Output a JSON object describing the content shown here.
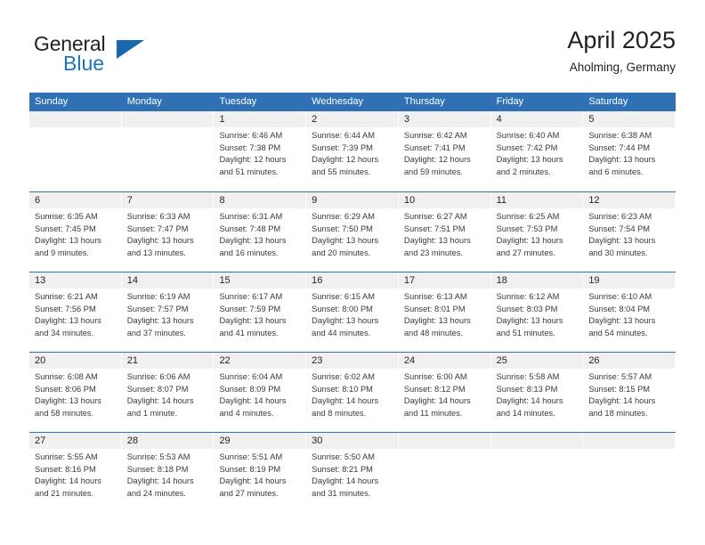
{
  "brand": {
    "name_top": "General",
    "name_bottom": "Blue",
    "triangle_icon": "blue-triangle-icon",
    "accent_color": "#1b75bb"
  },
  "header": {
    "title": "April 2025",
    "subtitle": "Aholming, Germany"
  },
  "theme": {
    "header_blue": "#3071b5",
    "daynum_band": "#f0f0f0",
    "text": "#231f20",
    "cell_text": "#3a3a3a"
  },
  "calendar": {
    "day_headers": [
      "Sunday",
      "Monday",
      "Tuesday",
      "Wednesday",
      "Thursday",
      "Friday",
      "Saturday"
    ],
    "weeks": [
      [
        {
          "day": "",
          "lines": []
        },
        {
          "day": "",
          "lines": []
        },
        {
          "day": "1",
          "lines": [
            "Sunrise: 6:46 AM",
            "Sunset: 7:38 PM",
            "Daylight: 12 hours",
            "and 51 minutes."
          ]
        },
        {
          "day": "2",
          "lines": [
            "Sunrise: 6:44 AM",
            "Sunset: 7:39 PM",
            "Daylight: 12 hours",
            "and 55 minutes."
          ]
        },
        {
          "day": "3",
          "lines": [
            "Sunrise: 6:42 AM",
            "Sunset: 7:41 PM",
            "Daylight: 12 hours",
            "and 59 minutes."
          ]
        },
        {
          "day": "4",
          "lines": [
            "Sunrise: 6:40 AM",
            "Sunset: 7:42 PM",
            "Daylight: 13 hours",
            "and 2 minutes."
          ]
        },
        {
          "day": "5",
          "lines": [
            "Sunrise: 6:38 AM",
            "Sunset: 7:44 PM",
            "Daylight: 13 hours",
            "and 6 minutes."
          ]
        }
      ],
      [
        {
          "day": "6",
          "lines": [
            "Sunrise: 6:35 AM",
            "Sunset: 7:45 PM",
            "Daylight: 13 hours",
            "and 9 minutes."
          ]
        },
        {
          "day": "7",
          "lines": [
            "Sunrise: 6:33 AM",
            "Sunset: 7:47 PM",
            "Daylight: 13 hours",
            "and 13 minutes."
          ]
        },
        {
          "day": "8",
          "lines": [
            "Sunrise: 6:31 AM",
            "Sunset: 7:48 PM",
            "Daylight: 13 hours",
            "and 16 minutes."
          ]
        },
        {
          "day": "9",
          "lines": [
            "Sunrise: 6:29 AM",
            "Sunset: 7:50 PM",
            "Daylight: 13 hours",
            "and 20 minutes."
          ]
        },
        {
          "day": "10",
          "lines": [
            "Sunrise: 6:27 AM",
            "Sunset: 7:51 PM",
            "Daylight: 13 hours",
            "and 23 minutes."
          ]
        },
        {
          "day": "11",
          "lines": [
            "Sunrise: 6:25 AM",
            "Sunset: 7:53 PM",
            "Daylight: 13 hours",
            "and 27 minutes."
          ]
        },
        {
          "day": "12",
          "lines": [
            "Sunrise: 6:23 AM",
            "Sunset: 7:54 PM",
            "Daylight: 13 hours",
            "and 30 minutes."
          ]
        }
      ],
      [
        {
          "day": "13",
          "lines": [
            "Sunrise: 6:21 AM",
            "Sunset: 7:56 PM",
            "Daylight: 13 hours",
            "and 34 minutes."
          ]
        },
        {
          "day": "14",
          "lines": [
            "Sunrise: 6:19 AM",
            "Sunset: 7:57 PM",
            "Daylight: 13 hours",
            "and 37 minutes."
          ]
        },
        {
          "day": "15",
          "lines": [
            "Sunrise: 6:17 AM",
            "Sunset: 7:59 PM",
            "Daylight: 13 hours",
            "and 41 minutes."
          ]
        },
        {
          "day": "16",
          "lines": [
            "Sunrise: 6:15 AM",
            "Sunset: 8:00 PM",
            "Daylight: 13 hours",
            "and 44 minutes."
          ]
        },
        {
          "day": "17",
          "lines": [
            "Sunrise: 6:13 AM",
            "Sunset: 8:01 PM",
            "Daylight: 13 hours",
            "and 48 minutes."
          ]
        },
        {
          "day": "18",
          "lines": [
            "Sunrise: 6:12 AM",
            "Sunset: 8:03 PM",
            "Daylight: 13 hours",
            "and 51 minutes."
          ]
        },
        {
          "day": "19",
          "lines": [
            "Sunrise: 6:10 AM",
            "Sunset: 8:04 PM",
            "Daylight: 13 hours",
            "and 54 minutes."
          ]
        }
      ],
      [
        {
          "day": "20",
          "lines": [
            "Sunrise: 6:08 AM",
            "Sunset: 8:06 PM",
            "Daylight: 13 hours",
            "and 58 minutes."
          ]
        },
        {
          "day": "21",
          "lines": [
            "Sunrise: 6:06 AM",
            "Sunset: 8:07 PM",
            "Daylight: 14 hours",
            "and 1 minute."
          ]
        },
        {
          "day": "22",
          "lines": [
            "Sunrise: 6:04 AM",
            "Sunset: 8:09 PM",
            "Daylight: 14 hours",
            "and 4 minutes."
          ]
        },
        {
          "day": "23",
          "lines": [
            "Sunrise: 6:02 AM",
            "Sunset: 8:10 PM",
            "Daylight: 14 hours",
            "and 8 minutes."
          ]
        },
        {
          "day": "24",
          "lines": [
            "Sunrise: 6:00 AM",
            "Sunset: 8:12 PM",
            "Daylight: 14 hours",
            "and 11 minutes."
          ]
        },
        {
          "day": "25",
          "lines": [
            "Sunrise: 5:58 AM",
            "Sunset: 8:13 PM",
            "Daylight: 14 hours",
            "and 14 minutes."
          ]
        },
        {
          "day": "26",
          "lines": [
            "Sunrise: 5:57 AM",
            "Sunset: 8:15 PM",
            "Daylight: 14 hours",
            "and 18 minutes."
          ]
        }
      ],
      [
        {
          "day": "27",
          "lines": [
            "Sunrise: 5:55 AM",
            "Sunset: 8:16 PM",
            "Daylight: 14 hours",
            "and 21 minutes."
          ]
        },
        {
          "day": "28",
          "lines": [
            "Sunrise: 5:53 AM",
            "Sunset: 8:18 PM",
            "Daylight: 14 hours",
            "and 24 minutes."
          ]
        },
        {
          "day": "29",
          "lines": [
            "Sunrise: 5:51 AM",
            "Sunset: 8:19 PM",
            "Daylight: 14 hours",
            "and 27 minutes."
          ]
        },
        {
          "day": "30",
          "lines": [
            "Sunrise: 5:50 AM",
            "Sunset: 8:21 PM",
            "Daylight: 14 hours",
            "and 31 minutes."
          ]
        },
        {
          "day": "",
          "lines": []
        },
        {
          "day": "",
          "lines": []
        },
        {
          "day": "",
          "lines": []
        }
      ]
    ]
  }
}
